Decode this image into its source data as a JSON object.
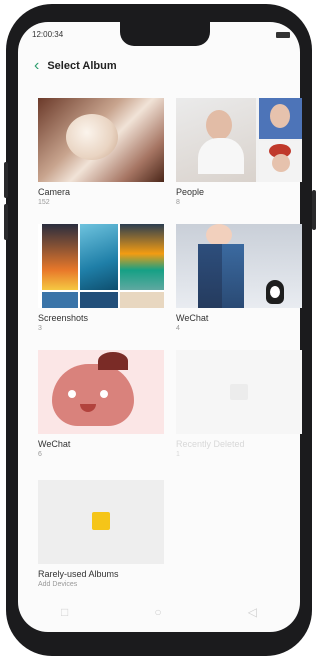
{
  "status_bar": {
    "time": "12:00:34"
  },
  "header": {
    "title": "Select Album",
    "back_icon": "back-arrow-icon"
  },
  "albums": [
    {
      "name": "Camera",
      "count": "152"
    },
    {
      "name": "People",
      "count": "8"
    },
    {
      "name": "Screenshots",
      "count": "3"
    },
    {
      "name": "WeChat",
      "count": "4"
    },
    {
      "name": "WeChat",
      "count": "6"
    },
    {
      "name": "Recently Deleted",
      "count": "1"
    },
    {
      "name": "Rarely-used Albums",
      "count": "Add Devices"
    }
  ],
  "nav": {
    "icons": [
      "square-icon",
      "circle-icon",
      "back-triangle-icon"
    ]
  },
  "colors": {
    "accent": "#2e9e6e",
    "background": "#fbfbfb"
  }
}
